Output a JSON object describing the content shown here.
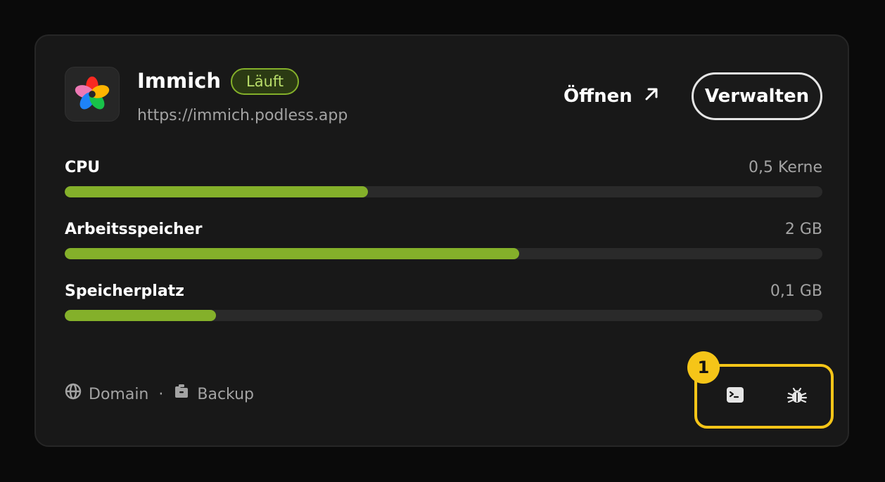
{
  "app": {
    "name": "Immich",
    "status": "Läuft",
    "url": "https://immich.podless.app",
    "icon": "immich-logo-icon"
  },
  "actions": {
    "open_label": "Öffnen",
    "open_icon": "arrow-up-right-icon",
    "manage_label": "Verwalten",
    "terminal_icon": "terminal-icon",
    "debug_icon": "bug-icon"
  },
  "metrics": [
    {
      "label": "CPU",
      "value": "0,5 Kerne",
      "fill_percent": 40
    },
    {
      "label": "Arbeitsspeicher",
      "value": "2 GB",
      "fill_percent": 60
    },
    {
      "label": "Speicherplatz",
      "value": "0,1 GB",
      "fill_percent": 20
    }
  ],
  "footer": {
    "domain_label": "Domain",
    "separator": "·",
    "backup_label": "Backup"
  },
  "annotation": {
    "marker": "1"
  },
  "colors": {
    "accent": "#84b02a",
    "highlight": "#f5c518",
    "card_bg": "#181818",
    "page_bg": "#0a0a0a"
  }
}
